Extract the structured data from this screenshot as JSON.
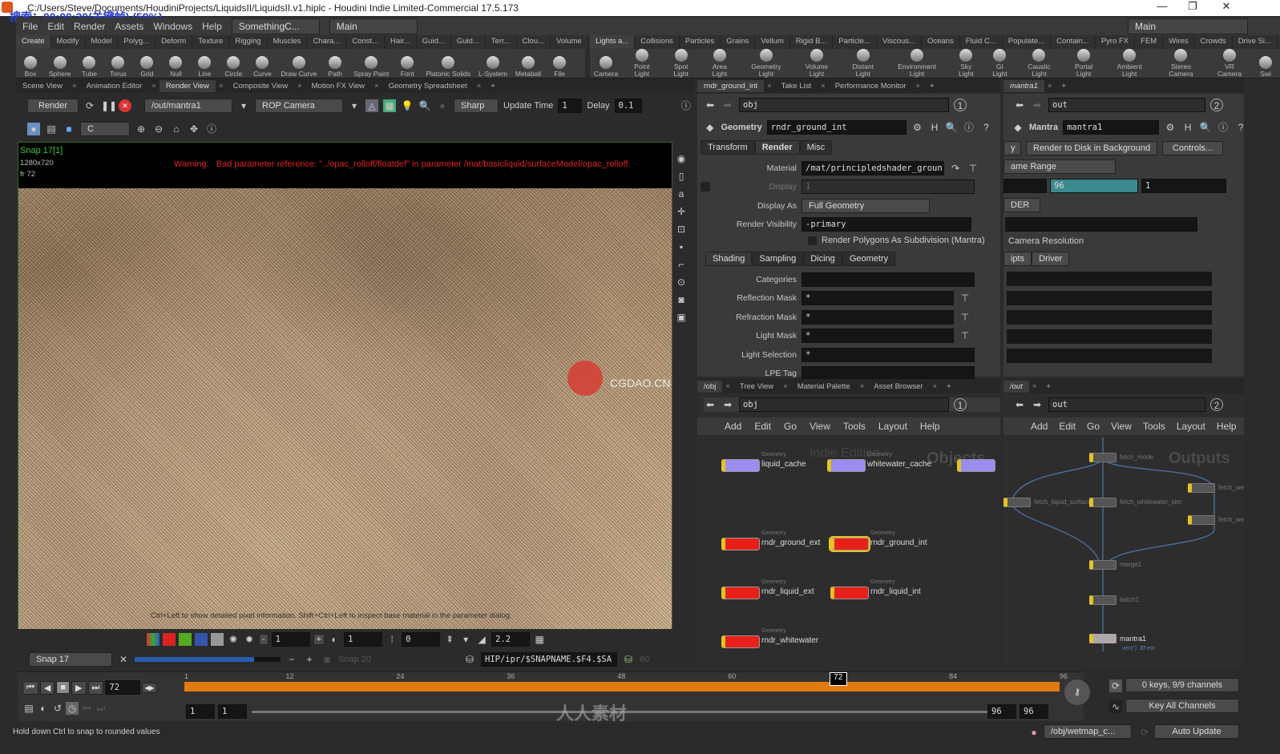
{
  "window": {
    "title": "C:/Users/Steve/Documents/HoudiniProjects/LiquidsII/LiquidsII.v1.hiplc - Houdini Indie Limited-Commercial 17.5.173",
    "overlay": "搜索：00:00:30(关键帧) (59%)",
    "minimize": "—",
    "maximize": "❐",
    "close": "✕"
  },
  "menu": {
    "items": [
      "File",
      "Edit",
      "Render",
      "Assets",
      "Windows",
      "Help"
    ],
    "desktop": "SomethingC...",
    "desktop2": "Main",
    "right_desktop": "Main"
  },
  "shelf_left": {
    "tabs": [
      "Create",
      "Modify",
      "Model",
      "Polyg...",
      "Deform",
      "Texture",
      "Rigging",
      "Muscles",
      "Chara...",
      "Const...",
      "Hair...",
      "Guid...",
      "Guid...",
      "Terr...",
      "Clou...",
      "Volume"
    ],
    "tools": [
      "Box",
      "Sphere",
      "Tube",
      "Torus",
      "Grid",
      "Null",
      "Line",
      "Circle",
      "Curve",
      "Draw Curve",
      "Path",
      "Spray Paint",
      "Font",
      "Platonic Solids",
      "L-System",
      "Metaball",
      "File"
    ]
  },
  "shelf_right": {
    "tabs": [
      "Lights a...",
      "Collisions",
      "Particles",
      "Grains",
      "Vellum",
      "Rigid B...",
      "Particle...",
      "Viscous...",
      "Oceans",
      "Fluid C...",
      "Populate...",
      "Contain...",
      "Pyro FX",
      "FEM",
      "Wires",
      "Crowds",
      "Drive Si..."
    ],
    "tools": [
      "Camera",
      "Point Light",
      "Spot Light",
      "Area Light",
      "Geometry Light",
      "Volume Light",
      "Distant Light",
      "Environment Light",
      "Sky Light",
      "GI Light",
      "Caustic Light",
      "Portal Light",
      "Ambient Light",
      "Stereo Camera",
      "VR Camera",
      "Swi"
    ]
  },
  "left_pane": {
    "tabs": [
      "Scene View",
      "Animation Editor",
      "Render View",
      "Composite View",
      "Motion FX View",
      "Geometry Spreadsheet"
    ],
    "toolbar": {
      "render": "Render",
      "rop": "/out/mantra1",
      "camera": "ROP Camera",
      "sharp": "Sharp",
      "update_label": "Update Time",
      "update_value": "1",
      "delay_label": "Delay",
      "delay_value": "0.1",
      "channel": "C"
    },
    "viewport": {
      "snap": "Snap 17[1]",
      "resolution": "1280x720",
      "frame": "fr 72",
      "channel": "C",
      "warning_label": "Warning:",
      "warning": "Bad parameter reference: \"../opac_rolloff/floatdef\" in parameter /mat/basicliquid/surfaceModel/opac_rolloff.",
      "hint": "Ctrl+Left to show detailed pixel information. Shift+Ctrl+Left to inspect base material in the parameter dialog.",
      "watermark": "CGDAO.CN"
    },
    "bottom": {
      "exposure": "1",
      "gamma_dial": "1",
      "offset": "0",
      "gamma": "2.2",
      "snap_select": "Snap 17",
      "snap_compare": "Snap 20",
      "path": "HIP/ipr/$SNAPNAME.$F4.$SA",
      "count": "60"
    }
  },
  "params": {
    "tabs": [
      "rndr_ground_int",
      "Take List",
      "Performance Monitor"
    ],
    "path": "obj",
    "type": "Geometry",
    "name": "rndr_ground_int",
    "ptabs": [
      "Transform",
      "Render",
      "Misc"
    ],
    "material_label": "Material",
    "material": "/mat/principledshader_groun",
    "display_label": "Display",
    "display": "1",
    "display_as_label": "Display As",
    "display_as": "Full Geometry",
    "vis_label": "Render Visibility",
    "vis": "-primary",
    "subdiv": "Render Polygons As Subdivision (Mantra)",
    "subtabs": [
      "Shading",
      "Sampling",
      "Dicing",
      "Geometry"
    ],
    "fields": [
      {
        "label": "Categories",
        "value": ""
      },
      {
        "label": "Reflection Mask",
        "value": "*"
      },
      {
        "label": "Refraction Mask",
        "value": "*"
      },
      {
        "label": "Light Mask",
        "value": "*"
      },
      {
        "label": "Light Selection",
        "value": "*"
      },
      {
        "label": "LPE Tag",
        "value": ""
      }
    ]
  },
  "mantra": {
    "tab": "mantra1",
    "path": "out",
    "type": "Mantra",
    "name": "mantra1",
    "render_bg": "Render to Disk in Background",
    "controls": "Controls...",
    "render_left": "y",
    "range": "ame Range",
    "end": "96",
    "inc": "1",
    "mode": "DER",
    "camres": "Camera Resolution",
    "subtabs": [
      "ipts",
      "Driver"
    ]
  },
  "obj_net": {
    "tabs": [
      "/obj",
      "Tree View",
      "Material Palette",
      "Asset Browser"
    ],
    "path": "obj",
    "menu": [
      "Add",
      "Edit",
      "Go",
      "View",
      "Tools",
      "Layout",
      "Help"
    ],
    "wm1": "Indie Edition",
    "wm2": "Objects",
    "nodes": [
      {
        "name": "liquid_cache",
        "type": "Geometry",
        "color": "#9b8cf0"
      },
      {
        "name": "whitewater_cache",
        "type": "Geometry",
        "color": "#9b8cf0"
      },
      {
        "name": "",
        "type": "",
        "color": "#9b8cf0"
      },
      {
        "name": "rndr_ground_ext",
        "type": "Geometry",
        "color": "#e8201a"
      },
      {
        "name": "rndr_ground_int",
        "type": "Geometry",
        "color": "#e8201a"
      },
      {
        "name": "rndr_liquid_ext",
        "type": "Geometry",
        "color": "#e8201a"
      },
      {
        "name": "rndr_liquid_int",
        "type": "Geometry",
        "color": "#e8201a"
      },
      {
        "name": "rndr_whitewater",
        "type": "Geometry",
        "color": "#e8201a"
      }
    ]
  },
  "out_net": {
    "tab": "/out",
    "path": "out",
    "menu": [
      "Add",
      "Edit",
      "Go",
      "View",
      "Tools",
      "Layout",
      "Help"
    ],
    "wm": "Outputs",
    "nodes": [
      "fetch_mode",
      "fetch_liquid_surfacer",
      "fetch_whitewater_sim",
      "fetch_wet",
      "fetch_wet",
      "merge1",
      "batch1",
      "mantra1"
    ],
    "mantra_expr": "vers\")`.$F.exr"
  },
  "timeline": {
    "frame": "72",
    "ticks": [
      "1",
      "12",
      "24",
      "36",
      "48",
      "60",
      "72",
      "84",
      "96"
    ],
    "start": "1",
    "start2": "1",
    "end": "96",
    "end2": "96",
    "keys": "0 keys, 9/9 channels",
    "key_all": "Key All Channels",
    "current_fraction": 0.747
  },
  "status": {
    "message": "Hold down Ctrl to snap to rounded values",
    "obj": "/obj/wetmap_c...",
    "update": "Auto Update",
    "watermark": "人人素材"
  },
  "colors": {
    "accent": "#e07b10",
    "panel": "#3a3a3a",
    "warning": "#e02020",
    "teal": "#3a8a8f"
  }
}
